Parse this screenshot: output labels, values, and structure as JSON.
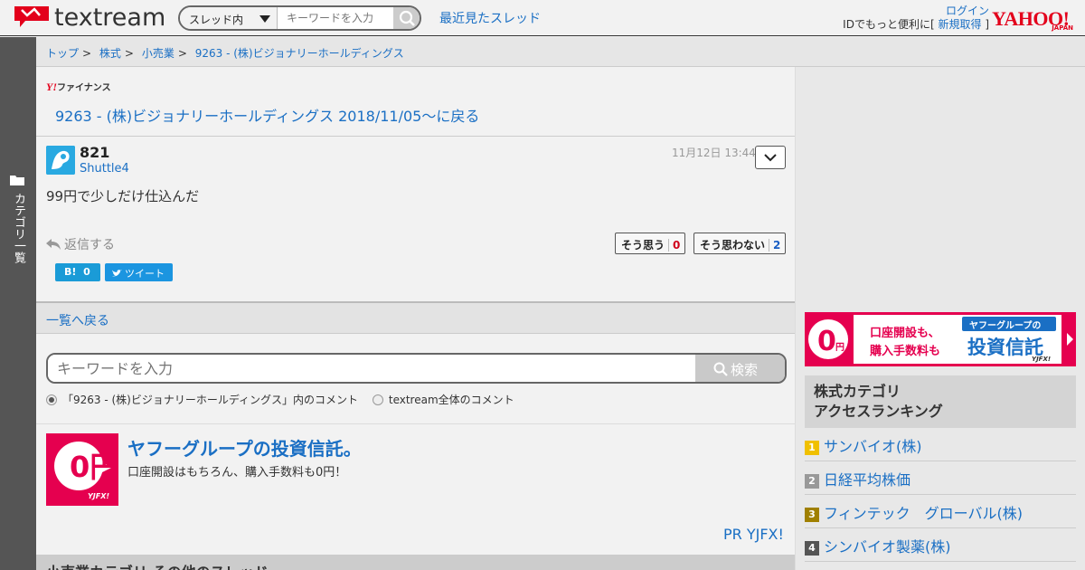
{
  "header": {
    "logo_text": "textream",
    "search_scope": "スレッド内",
    "search_placeholder": "キーワードを入力",
    "recent_threads": "最近見たスレッド",
    "login": "ログイン",
    "id_prompt": "IDでもっと便利に[",
    "register": "新規取得",
    "id_close": "]",
    "yahoo_logo": "YAHOO!",
    "yahoo_japan": "JAPAN"
  },
  "side_tab": {
    "label": "カテゴリ一覧"
  },
  "breadcrumb": [
    "トップ",
    "株式",
    "小売業",
    "9263 - (株)ビジョナリーホールディングス"
  ],
  "breadcrumb_sep": ">",
  "main": {
    "yfinance_y": "Y!",
    "yfinance_label": "ファイナンス",
    "back_to_thread": "9263 - (株)ビジョナリーホールディングス 2018/11/05〜に戻る",
    "post": {
      "number": "821",
      "user": "Shuttle4",
      "timestamp": "11月12日 13:44",
      "body": "99円で少しだけ仕込んだ",
      "reply": "返信する",
      "agree_label": "そう思う",
      "agree_count": "0",
      "disagree_label": "そう思わない",
      "disagree_count": "2",
      "hatena_label": "B!",
      "hatena_count": "0",
      "tweet_label": "ツイート"
    },
    "back_to_list": "一覧へ戻る",
    "search": {
      "placeholder": "キーワードを入力",
      "button": "検索",
      "option_thread": "「9263 - (株)ビジョナリーホールディングス」内のコメント",
      "option_all": "textream全体のコメント"
    },
    "ad": {
      "image_text": "0円",
      "image_brand": "YJFX!",
      "title": "ヤフーグループの投資信託。",
      "description": "口座開設はもちろん、購入手数料も0円！",
      "pr": "PR YJFX!"
    },
    "other_threads": "小売業カテゴリ その他のスレッド"
  },
  "right": {
    "banner": {
      "zero": "0",
      "yen": "円",
      "line1": "口座開設も、",
      "line2": "購入手数料も",
      "tag": "ヤフーグループの",
      "product": "投資信託",
      "brand": "YJFX!"
    },
    "ranking_title_1": "株式カテゴリ",
    "ranking_title_2": "アクセスランキング",
    "ranking": [
      {
        "rank": "1",
        "name": "サンバイオ(株)",
        "color": "#f0c000"
      },
      {
        "rank": "2",
        "name": "日経平均株価",
        "color": "#999999"
      },
      {
        "rank": "3",
        "name": "フィンテック　グローバル(株)",
        "color": "#a08000"
      },
      {
        "rank": "4",
        "name": "シンバイオ製薬(株)",
        "color": "#555555"
      }
    ]
  },
  "colors": {
    "link": "#1a6fc4",
    "brand_red": "#e3001b",
    "ad_pink": "#e5004f"
  }
}
